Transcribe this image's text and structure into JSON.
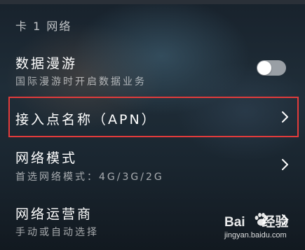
{
  "section": {
    "title": "卡 1 网络"
  },
  "rows": [
    {
      "title": "数据漫游",
      "subtitle": "国际漫游时开启数据业务",
      "toggle_state": "off"
    },
    {
      "title": "接入点名称（APN）"
    },
    {
      "title": "网络模式",
      "subtitle": "首选网络模式：4G/3G/2G"
    },
    {
      "title": "网络运营商",
      "subtitle": "手动或自动选择"
    }
  ],
  "watermark": {
    "brand_left": "Bai",
    "brand_right": "经验",
    "url": "jingyan.baidu.com"
  },
  "colors": {
    "highlight_border": "#e23b3b",
    "toggle_off": "#afb4b9"
  }
}
